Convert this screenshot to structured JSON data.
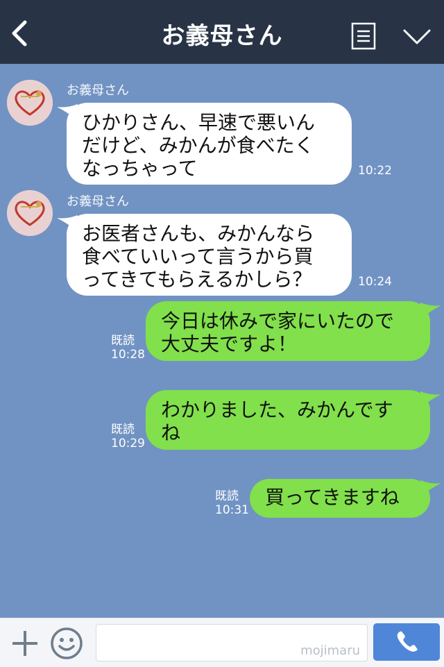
{
  "header": {
    "title": "お義母さん",
    "icons": [
      "chevron-left-icon",
      "menu-icon",
      "chevron-down-icon"
    ]
  },
  "messages": [
    {
      "direction": "incoming",
      "sender": "お義母さん",
      "lines": [
        "ひかりさん、早速で悪いん",
        "だけど、みかんが食べたく",
        "なっちゃって"
      ],
      "time": "10:22"
    },
    {
      "direction": "incoming",
      "sender": "お義母さん",
      "lines": [
        "お医者さんも、みかんなら",
        "食べていいって言うから買",
        "ってきてもらえるかしら？"
      ],
      "time": "10:24"
    },
    {
      "direction": "outgoing",
      "lines": [
        "今日は休みで家にいたので",
        "大丈夫ですよ！"
      ],
      "read": "既読",
      "time": "10:28"
    },
    {
      "direction": "outgoing",
      "lines": [
        "わかりました、みかんです",
        "ね"
      ],
      "read": "既読",
      "time": "10:29"
    },
    {
      "direction": "outgoing",
      "lines": [
        "買ってきますね"
      ],
      "read": "既読",
      "time": "10:31"
    }
  ],
  "footer": {
    "input_placeholder": "",
    "watermark": "mojimaru",
    "icons": [
      "plus-icon",
      "emoji-icon",
      "phone-icon"
    ]
  },
  "colors": {
    "background": "#7193c3",
    "header": "#283446",
    "incoming_bubble": "#ffffff",
    "outgoing_bubble": "#81e04b",
    "call_button": "#4f86d8"
  }
}
